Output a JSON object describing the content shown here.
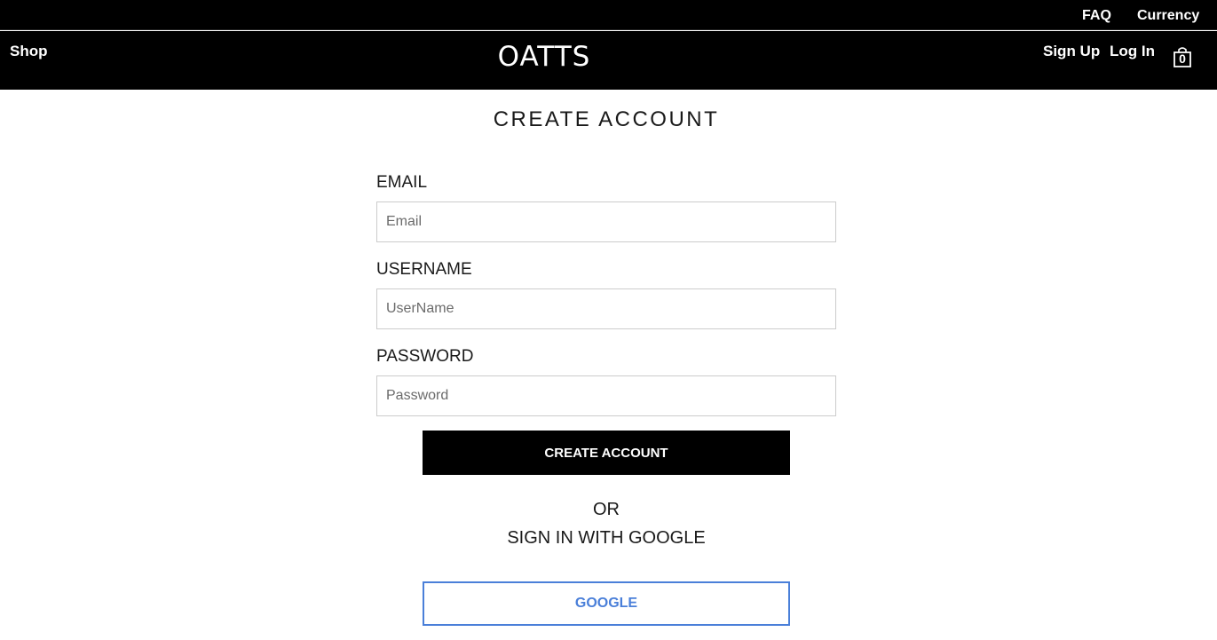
{
  "topbar": {
    "faq_label": "FAQ",
    "currency_label": "Currency"
  },
  "header": {
    "shop_label": "Shop",
    "logo": "OATTS",
    "signup_label": "Sign Up",
    "login_label": "Log In",
    "cart_count": "0",
    "cart_icon": "shopping-bag-icon"
  },
  "form": {
    "title": "CREATE ACCOUNT",
    "email": {
      "label": "EMAIL",
      "placeholder": "Email",
      "value": ""
    },
    "username": {
      "label": "USERNAME",
      "placeholder": "UserName",
      "value": ""
    },
    "password": {
      "label": "PASSWORD",
      "placeholder": "Password",
      "value": ""
    },
    "submit_label": "CREATE ACCOUNT",
    "or_text": "OR",
    "google_text": "SIGN IN WITH GOOGLE",
    "google_button_label": "GOOGLE"
  },
  "colors": {
    "header_bg": "#000000",
    "google_accent": "#4a7fd9",
    "field_border": "#cccccc"
  }
}
